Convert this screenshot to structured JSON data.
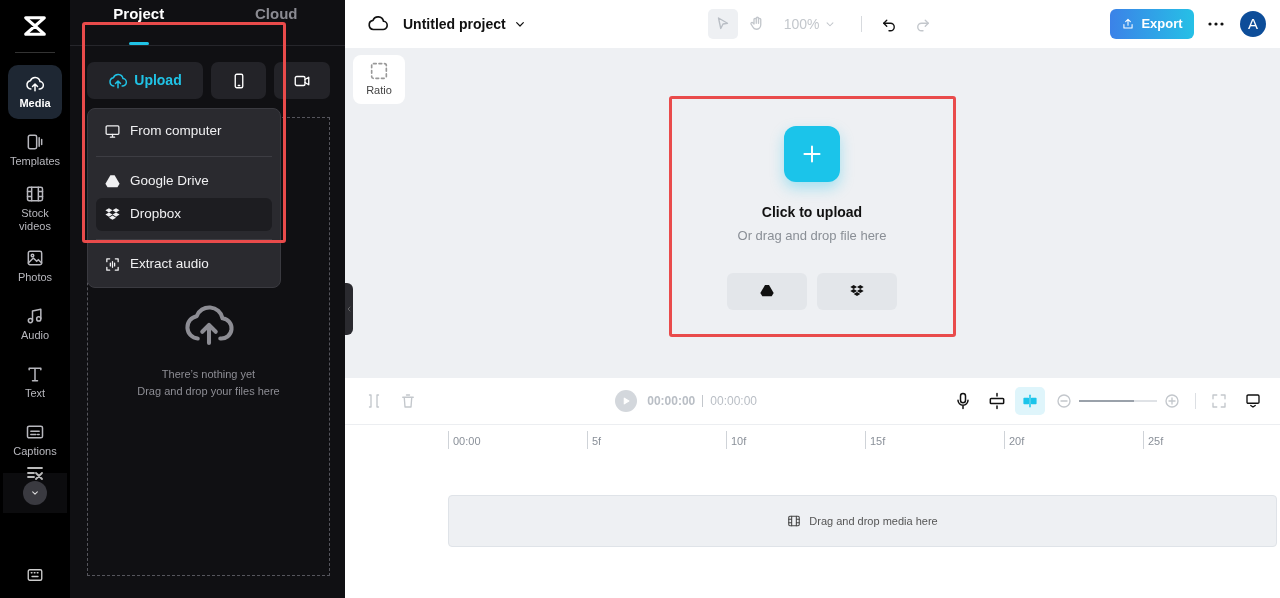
{
  "sidebar": {
    "items": [
      {
        "label": "Media",
        "selected": true
      },
      {
        "label": "Templates",
        "selected": false
      },
      {
        "label": "Stock videos",
        "selected": false
      },
      {
        "label": "Photos",
        "selected": false
      },
      {
        "label": "Audio",
        "selected": false
      },
      {
        "label": "Text",
        "selected": false
      },
      {
        "label": "Captions",
        "selected": false
      }
    ]
  },
  "panel": {
    "tabs": [
      {
        "label": "Project",
        "selected": true
      },
      {
        "label": "Cloud",
        "selected": false
      }
    ],
    "upload_button": "Upload",
    "upload_menu": {
      "highlight": true,
      "items": [
        {
          "label": "From computer",
          "selected": false
        },
        {
          "label": "Google Drive",
          "selected": false
        },
        {
          "label": "Dropbox",
          "selected": true
        },
        {
          "label": "Extract audio",
          "selected": false
        }
      ]
    },
    "empty_title": "There’s nothing yet",
    "empty_hint": "Drag and drop your files here"
  },
  "topbar": {
    "project_name": "Untitled project",
    "zoom": "100%",
    "export": "Export",
    "avatar": "A"
  },
  "canvas": {
    "ratio": "Ratio",
    "upload_card": {
      "highlight": true,
      "title": "Click to upload",
      "hint": "Or drag and drop file here"
    }
  },
  "timeline": {
    "current_time": "00:00:00",
    "total_time": "00:00:00",
    "zoom_slider": {
      "level": 0.7
    },
    "ruler": [
      "00:00",
      "5f",
      "10f",
      "15f",
      "20f",
      "25f"
    ],
    "track_hint": "Drag and drop media here"
  }
}
